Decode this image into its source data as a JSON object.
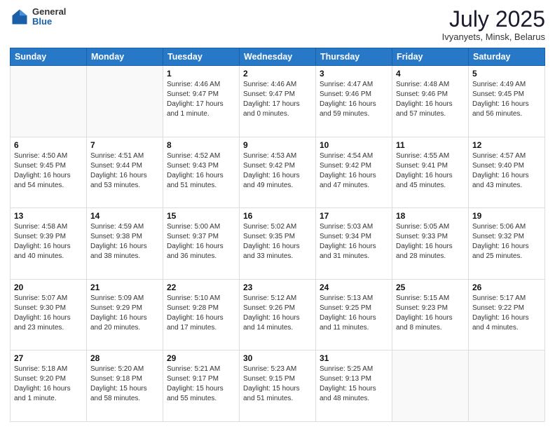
{
  "logo": {
    "general": "General",
    "blue": "Blue"
  },
  "title": "July 2025",
  "location": "Ivyanyets, Minsk, Belarus",
  "headers": [
    "Sunday",
    "Monday",
    "Tuesday",
    "Wednesday",
    "Thursday",
    "Friday",
    "Saturday"
  ],
  "weeks": [
    [
      {
        "day": "",
        "info": ""
      },
      {
        "day": "",
        "info": ""
      },
      {
        "day": "1",
        "info": "Sunrise: 4:46 AM\nSunset: 9:47 PM\nDaylight: 17 hours\nand 1 minute."
      },
      {
        "day": "2",
        "info": "Sunrise: 4:46 AM\nSunset: 9:47 PM\nDaylight: 17 hours\nand 0 minutes."
      },
      {
        "day": "3",
        "info": "Sunrise: 4:47 AM\nSunset: 9:46 PM\nDaylight: 16 hours\nand 59 minutes."
      },
      {
        "day": "4",
        "info": "Sunrise: 4:48 AM\nSunset: 9:46 PM\nDaylight: 16 hours\nand 57 minutes."
      },
      {
        "day": "5",
        "info": "Sunrise: 4:49 AM\nSunset: 9:45 PM\nDaylight: 16 hours\nand 56 minutes."
      }
    ],
    [
      {
        "day": "6",
        "info": "Sunrise: 4:50 AM\nSunset: 9:45 PM\nDaylight: 16 hours\nand 54 minutes."
      },
      {
        "day": "7",
        "info": "Sunrise: 4:51 AM\nSunset: 9:44 PM\nDaylight: 16 hours\nand 53 minutes."
      },
      {
        "day": "8",
        "info": "Sunrise: 4:52 AM\nSunset: 9:43 PM\nDaylight: 16 hours\nand 51 minutes."
      },
      {
        "day": "9",
        "info": "Sunrise: 4:53 AM\nSunset: 9:42 PM\nDaylight: 16 hours\nand 49 minutes."
      },
      {
        "day": "10",
        "info": "Sunrise: 4:54 AM\nSunset: 9:42 PM\nDaylight: 16 hours\nand 47 minutes."
      },
      {
        "day": "11",
        "info": "Sunrise: 4:55 AM\nSunset: 9:41 PM\nDaylight: 16 hours\nand 45 minutes."
      },
      {
        "day": "12",
        "info": "Sunrise: 4:57 AM\nSunset: 9:40 PM\nDaylight: 16 hours\nand 43 minutes."
      }
    ],
    [
      {
        "day": "13",
        "info": "Sunrise: 4:58 AM\nSunset: 9:39 PM\nDaylight: 16 hours\nand 40 minutes."
      },
      {
        "day": "14",
        "info": "Sunrise: 4:59 AM\nSunset: 9:38 PM\nDaylight: 16 hours\nand 38 minutes."
      },
      {
        "day": "15",
        "info": "Sunrise: 5:00 AM\nSunset: 9:37 PM\nDaylight: 16 hours\nand 36 minutes."
      },
      {
        "day": "16",
        "info": "Sunrise: 5:02 AM\nSunset: 9:35 PM\nDaylight: 16 hours\nand 33 minutes."
      },
      {
        "day": "17",
        "info": "Sunrise: 5:03 AM\nSunset: 9:34 PM\nDaylight: 16 hours\nand 31 minutes."
      },
      {
        "day": "18",
        "info": "Sunrise: 5:05 AM\nSunset: 9:33 PM\nDaylight: 16 hours\nand 28 minutes."
      },
      {
        "day": "19",
        "info": "Sunrise: 5:06 AM\nSunset: 9:32 PM\nDaylight: 16 hours\nand 25 minutes."
      }
    ],
    [
      {
        "day": "20",
        "info": "Sunrise: 5:07 AM\nSunset: 9:30 PM\nDaylight: 16 hours\nand 23 minutes."
      },
      {
        "day": "21",
        "info": "Sunrise: 5:09 AM\nSunset: 9:29 PM\nDaylight: 16 hours\nand 20 minutes."
      },
      {
        "day": "22",
        "info": "Sunrise: 5:10 AM\nSunset: 9:28 PM\nDaylight: 16 hours\nand 17 minutes."
      },
      {
        "day": "23",
        "info": "Sunrise: 5:12 AM\nSunset: 9:26 PM\nDaylight: 16 hours\nand 14 minutes."
      },
      {
        "day": "24",
        "info": "Sunrise: 5:13 AM\nSunset: 9:25 PM\nDaylight: 16 hours\nand 11 minutes."
      },
      {
        "day": "25",
        "info": "Sunrise: 5:15 AM\nSunset: 9:23 PM\nDaylight: 16 hours\nand 8 minutes."
      },
      {
        "day": "26",
        "info": "Sunrise: 5:17 AM\nSunset: 9:22 PM\nDaylight: 16 hours\nand 4 minutes."
      }
    ],
    [
      {
        "day": "27",
        "info": "Sunrise: 5:18 AM\nSunset: 9:20 PM\nDaylight: 16 hours\nand 1 minute."
      },
      {
        "day": "28",
        "info": "Sunrise: 5:20 AM\nSunset: 9:18 PM\nDaylight: 15 hours\nand 58 minutes."
      },
      {
        "day": "29",
        "info": "Sunrise: 5:21 AM\nSunset: 9:17 PM\nDaylight: 15 hours\nand 55 minutes."
      },
      {
        "day": "30",
        "info": "Sunrise: 5:23 AM\nSunset: 9:15 PM\nDaylight: 15 hours\nand 51 minutes."
      },
      {
        "day": "31",
        "info": "Sunrise: 5:25 AM\nSunset: 9:13 PM\nDaylight: 15 hours\nand 48 minutes."
      },
      {
        "day": "",
        "info": ""
      },
      {
        "day": "",
        "info": ""
      }
    ]
  ]
}
